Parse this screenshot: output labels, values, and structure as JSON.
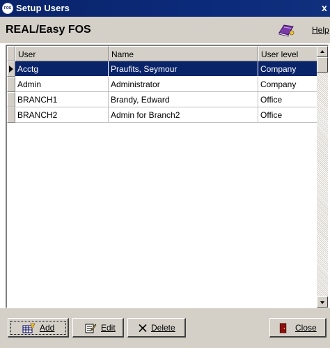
{
  "window": {
    "title": "Setup Users",
    "app_icon_text": "FOS",
    "close_glyph": "x"
  },
  "header": {
    "app_name": "REAL/Easy FOS",
    "help_label": "Help",
    "help_icon": "help-book-icon"
  },
  "grid": {
    "columns": [
      "User",
      "Name",
      "User level"
    ],
    "selected_row_index": 0,
    "rows": [
      {
        "user": "Acctg",
        "name": "Praufits, Seymour",
        "level": "Company"
      },
      {
        "user": "Admin",
        "name": "Administrator",
        "level": "Company"
      },
      {
        "user": "BRANCH1",
        "name": "Brandy, Edward",
        "level": "Office"
      },
      {
        "user": "BRANCH2",
        "name": "Admin for Branch2",
        "level": "Office"
      }
    ],
    "selection_color": "#0a246a"
  },
  "buttons": {
    "add_label": "Add",
    "edit_label": "Edit",
    "delete_label": "Delete",
    "close_label": "Close",
    "add_icon": "add-record-icon",
    "edit_icon": "edit-record-icon",
    "delete_icon": "delete-x-icon",
    "close_icon": "exit-door-icon"
  },
  "colors": {
    "titlebar": "#0a246a",
    "face": "#d4d0c8",
    "selection": "#0a246a"
  }
}
